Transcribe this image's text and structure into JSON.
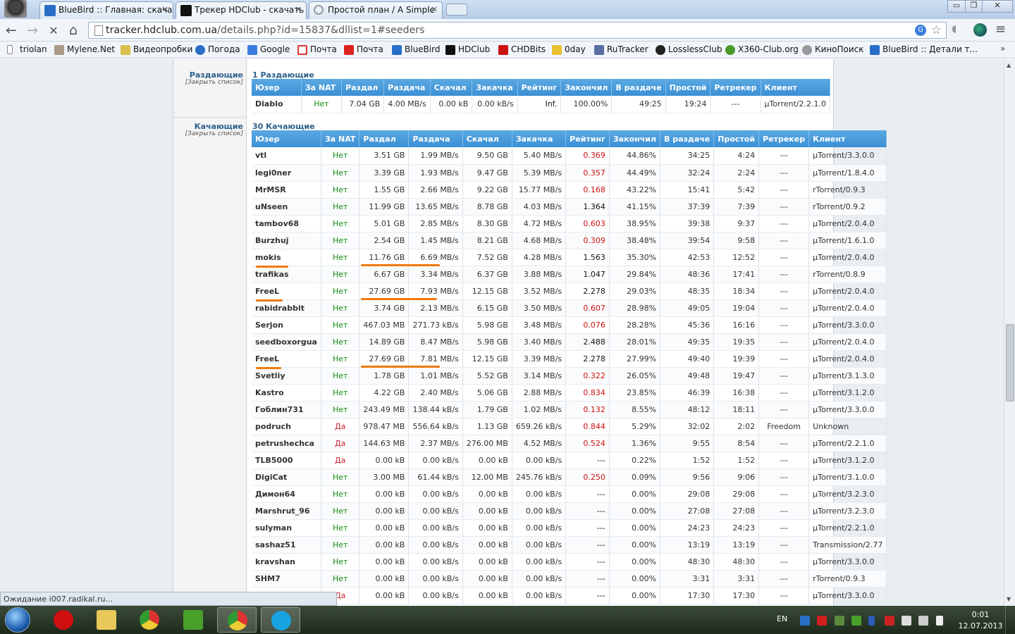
{
  "tabs": [
    {
      "title": "BlueBird :: Главная: скача"
    },
    {
      "title": "Трекер HDClub - скачать"
    },
    {
      "title": "Простой план / A Simple"
    }
  ],
  "window": {
    "minimize": "▭",
    "restore": "❐",
    "close": "✕"
  },
  "toolbar": {
    "back": "←",
    "forward": "→",
    "stop": "✕",
    "home": "⌂"
  },
  "address": {
    "host": "tracker.hdclub.com.ua",
    "path": "/details.php?id=15837&dllist=1#seeders"
  },
  "bookmarks": [
    {
      "label": "triolan",
      "icon": "folder-icon"
    },
    {
      "label": "Mylene.Net",
      "icon": "photo-icon"
    },
    {
      "label": "Видеопробки",
      "icon": "car-icon"
    },
    {
      "label": "Погода",
      "icon": "weather-icon"
    },
    {
      "label": "Google",
      "icon": "google-icon"
    },
    {
      "label": "Почта",
      "icon": "gmail-icon"
    },
    {
      "label": "Почта",
      "icon": "mail-icon"
    },
    {
      "label": "BlueBird",
      "icon": "bluebird-icon"
    },
    {
      "label": "HDClub",
      "icon": "hdclub-icon"
    },
    {
      "label": "CHDBits",
      "icon": "chdbits-icon"
    },
    {
      "label": "0day",
      "icon": "0day-icon"
    },
    {
      "label": "RuTracker",
      "icon": "rutracker-icon"
    },
    {
      "label": "LosslessClub",
      "icon": "lossless-icon"
    },
    {
      "label": "X360-Club.org",
      "icon": "x360-icon"
    },
    {
      "label": "КиноПоиск",
      "icon": "kinopoisk-icon"
    },
    {
      "label": "BlueBird :: Детали т...",
      "icon": "bluebird-icon"
    }
  ],
  "bookmarks_more": "»",
  "seeders": {
    "label": "Раздающие",
    "close": "[Закрыть список]",
    "count": "1 Раздающие",
    "headers": [
      "Юзер",
      "За NAT",
      "Раздал",
      "Раздача",
      "Скачал",
      "Закачка",
      "Рейтинг",
      "Закончил",
      "В раздаче",
      "Простой",
      "Ретрекер",
      "Клиент"
    ],
    "rows": [
      {
        "user": "Diablo",
        "color": "orange",
        "nat": "Нет",
        "up": "7.04 GB",
        "up_speed": "4.00 MB/s",
        "down": "0.00 kB",
        "down_speed": "0.00 kB/s",
        "ratio": "Inf.",
        "done": "100.00%",
        "seeding": "49:25",
        "idle": "19:24",
        "retracker": "---",
        "client": "µTorrent/2.2.1.0"
      }
    ]
  },
  "leechers": {
    "label": "Качающие",
    "close": "[Закрыть список]",
    "count": "30 Качающие",
    "headers": [
      "Юзер",
      "За NAT",
      "Раздал",
      "Раздача",
      "Скачал",
      "Закачка",
      "Рейтинг",
      "Закончил",
      "В раздаче",
      "Простой",
      "Ретрекер",
      "Клиент"
    ],
    "rows": [
      {
        "user": "vtl",
        "color": "darkblue",
        "nat": "Нет",
        "up": "3.51 GB",
        "up_speed": "1.99 MB/s",
        "down": "9.50 GB",
        "down_speed": "5.40 MB/s",
        "ratio": "0.369",
        "ratio_color": "red",
        "done": "44.86%",
        "seeding": "34:25",
        "idle": "4:24",
        "retracker": "---",
        "client": "µTorrent/3.3.0.0"
      },
      {
        "user": "legi0ner",
        "color": "red",
        "nat": "Нет",
        "up": "3.39 GB",
        "up_speed": "1.93 MB/s",
        "down": "9.47 GB",
        "down_speed": "5.39 MB/s",
        "ratio": "0.357",
        "ratio_color": "red",
        "done": "44.49%",
        "seeding": "32:24",
        "idle": "2:24",
        "retracker": "---",
        "client": "µTorrent/1.8.4.0"
      },
      {
        "user": "MrMSR",
        "color": "black",
        "nat": "Нет",
        "up": "1.55 GB",
        "up_speed": "2.66 MB/s",
        "down": "9.22 GB",
        "down_speed": "15.77 MB/s",
        "ratio": "0.168",
        "ratio_color": "red",
        "done": "43.22%",
        "seeding": "15:41",
        "idle": "5:42",
        "retracker": "---",
        "client": "rTorrent/0.9.3"
      },
      {
        "user": "uNseen",
        "color": "blue",
        "nat": "Нет",
        "up": "11.99 GB",
        "up_speed": "13.65 MB/s",
        "down": "8.78 GB",
        "down_speed": "4.03 MB/s",
        "ratio": "1.364",
        "ratio_color": "black",
        "done": "41.15%",
        "seeding": "37:39",
        "idle": "7:39",
        "retracker": "---",
        "client": "rTorrent/0.9.2"
      },
      {
        "user": "tambov68",
        "color": "blue",
        "nat": "Нет",
        "up": "5.01 GB",
        "up_speed": "2.85 MB/s",
        "down": "8.30 GB",
        "down_speed": "4.72 MB/s",
        "ratio": "0.603",
        "ratio_color": "red",
        "done": "38.95%",
        "seeding": "39:38",
        "idle": "9:37",
        "retracker": "---",
        "client": "µTorrent/2.0.4.0"
      },
      {
        "user": "Burzhuj",
        "color": "blue",
        "nat": "Нет",
        "up": "2.54 GB",
        "up_speed": "1.45 MB/s",
        "down": "8.21 GB",
        "down_speed": "4.68 MB/s",
        "ratio": "0.309",
        "ratio_color": "red",
        "done": "38.48%",
        "seeding": "39:54",
        "idle": "9:58",
        "retracker": "---",
        "client": "µTorrent/1.6.1.0"
      },
      {
        "user": "mokis",
        "color": "blue",
        "nat": "Нет",
        "up": "11.76 GB",
        "up_speed": "6.69 MB/s",
        "down": "7.52 GB",
        "down_speed": "4.28 MB/s",
        "ratio": "1.563",
        "ratio_color": "black",
        "done": "35.30%",
        "seeding": "42:53",
        "idle": "12:52",
        "retracker": "---",
        "client": "µTorrent/2.0.4.0"
      },
      {
        "user": "trafikas",
        "color": "red",
        "nat": "Нет",
        "up": "6.67 GB",
        "up_speed": "3.34 MB/s",
        "down": "6.37 GB",
        "down_speed": "3.88 MB/s",
        "ratio": "1.047",
        "ratio_color": "black",
        "done": "29.84%",
        "seeding": "48:36",
        "idle": "17:41",
        "retracker": "---",
        "client": "rTorrent/0.8.9"
      },
      {
        "user": "FreeL",
        "color": "blue",
        "nat": "Нет",
        "up": "27.69 GB",
        "up_speed": "7.93 MB/s",
        "down": "12.15 GB",
        "down_speed": "3.52 MB/s",
        "ratio": "2.278",
        "ratio_color": "black",
        "done": "29.03%",
        "seeding": "48:35",
        "idle": "18:34",
        "retracker": "---",
        "client": "µTorrent/2.0.4.0"
      },
      {
        "user": "rabidrabbit",
        "color": "blue",
        "nat": "Нет",
        "up": "3.74 GB",
        "up_speed": "2.13 MB/s",
        "down": "6.15 GB",
        "down_speed": "3.50 MB/s",
        "ratio": "0.607",
        "ratio_color": "red",
        "done": "28.98%",
        "seeding": "49:05",
        "idle": "19:04",
        "retracker": "---",
        "client": "µTorrent/2.0.4.0"
      },
      {
        "user": "Serjon",
        "color": "black",
        "nat": "Нет",
        "up": "467.03 MB",
        "up_speed": "271.73 kB/s",
        "down": "5.98 GB",
        "down_speed": "3.48 MB/s",
        "ratio": "0.076",
        "ratio_color": "red",
        "done": "28.28%",
        "seeding": "45:36",
        "idle": "16:16",
        "retracker": "---",
        "client": "µTorrent/3.3.0.0"
      },
      {
        "user": "seedboxorgua",
        "color": "blue",
        "nat": "Нет",
        "up": "14.89 GB",
        "up_speed": "8.47 MB/s",
        "down": "5.98 GB",
        "down_speed": "3.40 MB/s",
        "ratio": "2.488",
        "ratio_color": "black",
        "done": "28.01%",
        "seeding": "49:35",
        "idle": "19:35",
        "retracker": "---",
        "client": "µTorrent/2.0.4.0"
      },
      {
        "user": "FreeL",
        "color": "blue",
        "nat": "Нет",
        "up": "27.69 GB",
        "up_speed": "7.81 MB/s",
        "down": "12.15 GB",
        "down_speed": "3.39 MB/s",
        "ratio": "2.278",
        "ratio_color": "black",
        "done": "27.99%",
        "seeding": "49:40",
        "idle": "19:39",
        "retracker": "---",
        "client": "µTorrent/2.0.4.0"
      },
      {
        "user": "Svetliy",
        "color": "purple",
        "nat": "Нет",
        "up": "1.78 GB",
        "up_speed": "1.01 MB/s",
        "down": "5.52 GB",
        "down_speed": "3.14 MB/s",
        "ratio": "0.322",
        "ratio_color": "red",
        "done": "26.05%",
        "seeding": "49:48",
        "idle": "19:47",
        "retracker": "---",
        "client": "µTorrent/3.1.3.0"
      },
      {
        "user": "Kastro",
        "color": "red",
        "nat": "Нет",
        "up": "4.22 GB",
        "up_speed": "2.40 MB/s",
        "down": "5.06 GB",
        "down_speed": "2.88 MB/s",
        "ratio": "0.834",
        "ratio_color": "red",
        "done": "23.85%",
        "seeding": "46:39",
        "idle": "16:38",
        "retracker": "---",
        "client": "µTorrent/3.1.2.0"
      },
      {
        "user": "Гоблин731",
        "color": "purple",
        "nat": "Нет",
        "up": "243.49 MB",
        "up_speed": "138.44 kB/s",
        "down": "1.79 GB",
        "down_speed": "1.02 MB/s",
        "ratio": "0.132",
        "ratio_color": "red",
        "done": "8.55%",
        "seeding": "48:12",
        "idle": "18:11",
        "retracker": "---",
        "client": "µTorrent/3.3.0.0"
      },
      {
        "user": "podruch",
        "color": "purple",
        "nat": "Да",
        "up": "978.47 MB",
        "up_speed": "556.64 kB/s",
        "down": "1.13 GB",
        "down_speed": "659.26 kB/s",
        "ratio": "0.844",
        "ratio_color": "red",
        "done": "5.29%",
        "seeding": "32:02",
        "idle": "2:02",
        "retracker": "Freedom",
        "client": "Unknown"
      },
      {
        "user": "petrushechca",
        "color": "purple",
        "nat": "Да",
        "up": "144.63 MB",
        "up_speed": "2.37 MB/s",
        "down": "276.00 MB",
        "down_speed": "4.52 MB/s",
        "ratio": "0.524",
        "ratio_color": "red",
        "done": "1.36%",
        "seeding": "9:55",
        "idle": "8:54",
        "retracker": "---",
        "client": "µTorrent/2.2.1.0"
      },
      {
        "user": "TLB5000",
        "color": "purple",
        "nat": "Да",
        "up": "0.00 kB",
        "up_speed": "0.00 kB/s",
        "down": "0.00 kB",
        "down_speed": "0.00 kB/s",
        "ratio": "---",
        "ratio_color": "black",
        "done": "0.22%",
        "seeding": "1:52",
        "idle": "1:52",
        "retracker": "---",
        "client": "µTorrent/3.1.2.0"
      },
      {
        "user": "DigiCat",
        "color": "blue",
        "nat": "Нет",
        "up": "3.00 MB",
        "up_speed": "61.44 kB/s",
        "down": "12.00 MB",
        "down_speed": "245.76 kB/s",
        "ratio": "0.250",
        "ratio_color": "red",
        "done": "0.09%",
        "seeding": "9:56",
        "idle": "9:06",
        "retracker": "---",
        "client": "µTorrent/3.1.0.0"
      },
      {
        "user": "Димон64",
        "color": "blue",
        "nat": "Нет",
        "up": "0.00 kB",
        "up_speed": "0.00 kB/s",
        "down": "0.00 kB",
        "down_speed": "0.00 kB/s",
        "ratio": "---",
        "ratio_color": "black",
        "done": "0.00%",
        "seeding": "29:08",
        "idle": "29:08",
        "retracker": "---",
        "client": "µTorrent/3.2.3.0"
      },
      {
        "user": "Marshrut_96",
        "color": "red",
        "nat": "Нет",
        "up": "0.00 kB",
        "up_speed": "0.00 kB/s",
        "down": "0.00 kB",
        "down_speed": "0.00 kB/s",
        "ratio": "---",
        "ratio_color": "black",
        "done": "0.00%",
        "seeding": "27:08",
        "idle": "27:08",
        "retracker": "---",
        "client": "µTorrent/3.2.3.0"
      },
      {
        "user": "sulyman",
        "color": "blue",
        "nat": "Нет",
        "up": "0.00 kB",
        "up_speed": "0.00 kB/s",
        "down": "0.00 kB",
        "down_speed": "0.00 kB/s",
        "ratio": "---",
        "ratio_color": "black",
        "done": "0.00%",
        "seeding": "24:23",
        "idle": "24:23",
        "retracker": "---",
        "client": "µTorrent/2.2.1.0"
      },
      {
        "user": "sashaz51",
        "color": "red",
        "nat": "Нет",
        "up": "0.00 kB",
        "up_speed": "0.00 kB/s",
        "down": "0.00 kB",
        "down_speed": "0.00 kB/s",
        "ratio": "---",
        "ratio_color": "black",
        "done": "0.00%",
        "seeding": "13:19",
        "idle": "13:19",
        "retracker": "---",
        "client": "Transmission/2.77"
      },
      {
        "user": "kravshan",
        "color": "black",
        "nat": "Нет",
        "up": "0.00 kB",
        "up_speed": "0.00 kB/s",
        "down": "0.00 kB",
        "down_speed": "0.00 kB/s",
        "ratio": "---",
        "ratio_color": "black",
        "done": "0.00%",
        "seeding": "48:30",
        "idle": "48:30",
        "retracker": "---",
        "client": "µTorrent/3.3.0.0"
      },
      {
        "user": "SHM7",
        "color": "red",
        "nat": "Нет",
        "up": "0.00 kB",
        "up_speed": "0.00 kB/s",
        "down": "0.00 kB",
        "down_speed": "0.00 kB/s",
        "ratio": "---",
        "ratio_color": "black",
        "done": "0.00%",
        "seeding": "3:31",
        "idle": "3:31",
        "retracker": "---",
        "client": "rTorrent/0.9.3"
      },
      {
        "user": "",
        "color": "black",
        "nat": "Да",
        "up": "0.00 kB",
        "up_speed": "0.00 kB/s",
        "down": "0.00 kB",
        "down_speed": "0.00 kB/s",
        "ratio": "---",
        "ratio_color": "black",
        "done": "0.00%",
        "seeding": "17:30",
        "idle": "17:30",
        "retracker": "---",
        "client": "µTorrent/3.3.0.0"
      }
    ]
  },
  "status": "Ожидание i007.radikal.ru...",
  "taskbar": {
    "apps": [
      {
        "name": "opera-icon",
        "color": "#d01010"
      },
      {
        "name": "explorer-icon",
        "color": "#e8c85a"
      },
      {
        "name": "chrome-icon",
        "color": "#3a9a3a"
      },
      {
        "name": "utorrent-icon",
        "color": "#49a02a"
      },
      {
        "name": "chrome-active-icon",
        "color": "#3a9a3a"
      },
      {
        "name": "skype-icon",
        "color": "#18a2e0"
      }
    ],
    "lang": "EN",
    "time": "0:01",
    "date": "12.07.2013"
  }
}
